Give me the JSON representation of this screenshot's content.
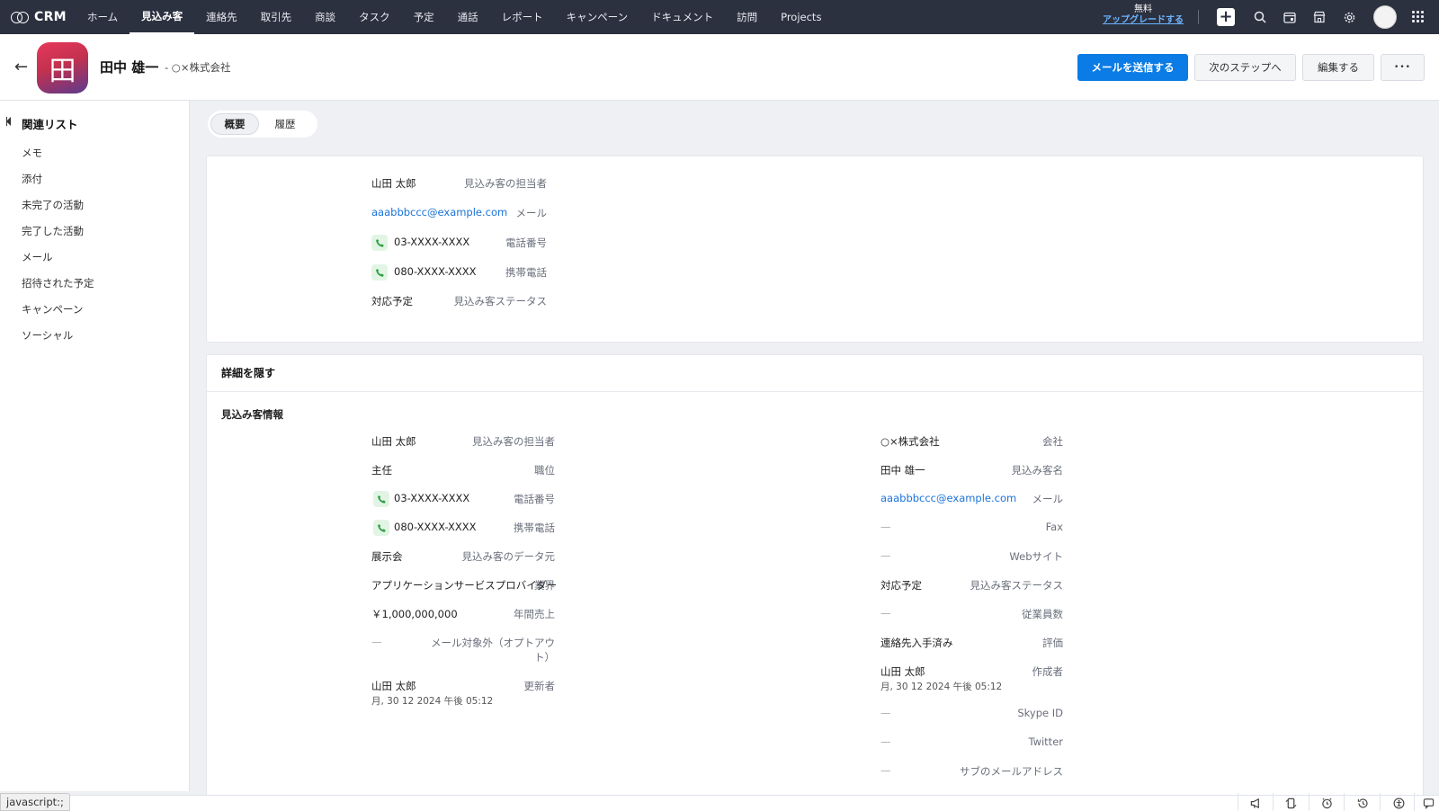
{
  "nav": {
    "brand": "CRM",
    "items": [
      "ホーム",
      "見込み客",
      "連絡先",
      "取引先",
      "商談",
      "タスク",
      "予定",
      "通話",
      "レポート",
      "キャンペーン",
      "ドキュメント",
      "訪問",
      "Projects"
    ],
    "active_index": 1,
    "upgrade_free": "無料",
    "upgrade_link": "アップグレードする"
  },
  "record": {
    "avatar_char": "田",
    "name": "田中 雄一",
    "company_suffix": "- ○×株式会社",
    "buttons": {
      "send_mail": "メールを送信する",
      "next_step": "次のステップへ",
      "edit": "編集する",
      "more": "•••"
    }
  },
  "sidebar": {
    "title": "関連リスト",
    "items": [
      "メモ",
      "添付",
      "未完了の活動",
      "完了した活動",
      "メール",
      "招待された予定",
      "キャンペーン",
      "ソーシャル"
    ]
  },
  "tabs": [
    "概要",
    "履歴"
  ],
  "overview": {
    "fields": [
      {
        "label": "見込み客の担当者",
        "value": "山田 太郎"
      },
      {
        "label": "メール",
        "value": "aaabbbccc@example.com"
      },
      {
        "label": "電話番号",
        "value": "03-XXXX-XXXX"
      },
      {
        "label": "携帯電話",
        "value": "080-XXXX-XXXX"
      },
      {
        "label": "見込み客ステータス",
        "value": "対応予定"
      }
    ]
  },
  "details": {
    "toggle": "詳細を隠す",
    "section_title": "見込み客情報",
    "left": [
      {
        "label": "見込み客の担当者",
        "value": "山田 太郎"
      },
      {
        "label": "職位",
        "value": "主任"
      },
      {
        "label": "電話番号",
        "value": "03-XXXX-XXXX"
      },
      {
        "label": "携帯電話",
        "value": "080-XXXX-XXXX"
      },
      {
        "label": "見込み客のデータ元",
        "value": "展示会"
      },
      {
        "label": "業界",
        "value": "アプリケーションサービスプロバイダー"
      },
      {
        "label": "年間売上",
        "value": "￥1,000,000,000"
      },
      {
        "label": "メール対象外（オプトアウ",
        "label2": "ト）",
        "value": "—"
      },
      {
        "label": "更新者",
        "value": "山田 太郎",
        "sub": "月, 30 12 2024 午後 05:12"
      }
    ],
    "right": [
      {
        "label": "会社",
        "value": "○×株式会社"
      },
      {
        "label": "見込み客名",
        "value": "田中 雄一"
      },
      {
        "label": "メール",
        "value": "aaabbbccc@example.com"
      },
      {
        "label": "Fax",
        "value": "—"
      },
      {
        "label": "Webサイト",
        "value": "—"
      },
      {
        "label": "見込み客ステータス",
        "value": "対応予定"
      },
      {
        "label": "従業員数",
        "value": "—"
      },
      {
        "label": "評価",
        "value": "連絡先入手済み"
      },
      {
        "label": "作成者",
        "value": "山田 太郎",
        "sub": "月, 30 12 2024 午後 05:12"
      },
      {
        "label": "Skype ID",
        "value": "—"
      },
      {
        "label": "Twitter",
        "value": "—"
      },
      {
        "label": "サブのメールアドレス",
        "value": "—"
      }
    ]
  },
  "statusbar": {
    "link_preview": "javascript:;"
  },
  "icons": {
    "search": "search-icon",
    "calendar": "calendar-icon",
    "store": "store-icon",
    "settings": "gear-icon",
    "apps": "apps-grid-icon",
    "phone": "phone-icon"
  },
  "colors": {
    "nav_bg": "#2c3140",
    "primary": "#0b7ce5",
    "link": "#1a73d9",
    "phone_bg": "#e2f5e4"
  }
}
